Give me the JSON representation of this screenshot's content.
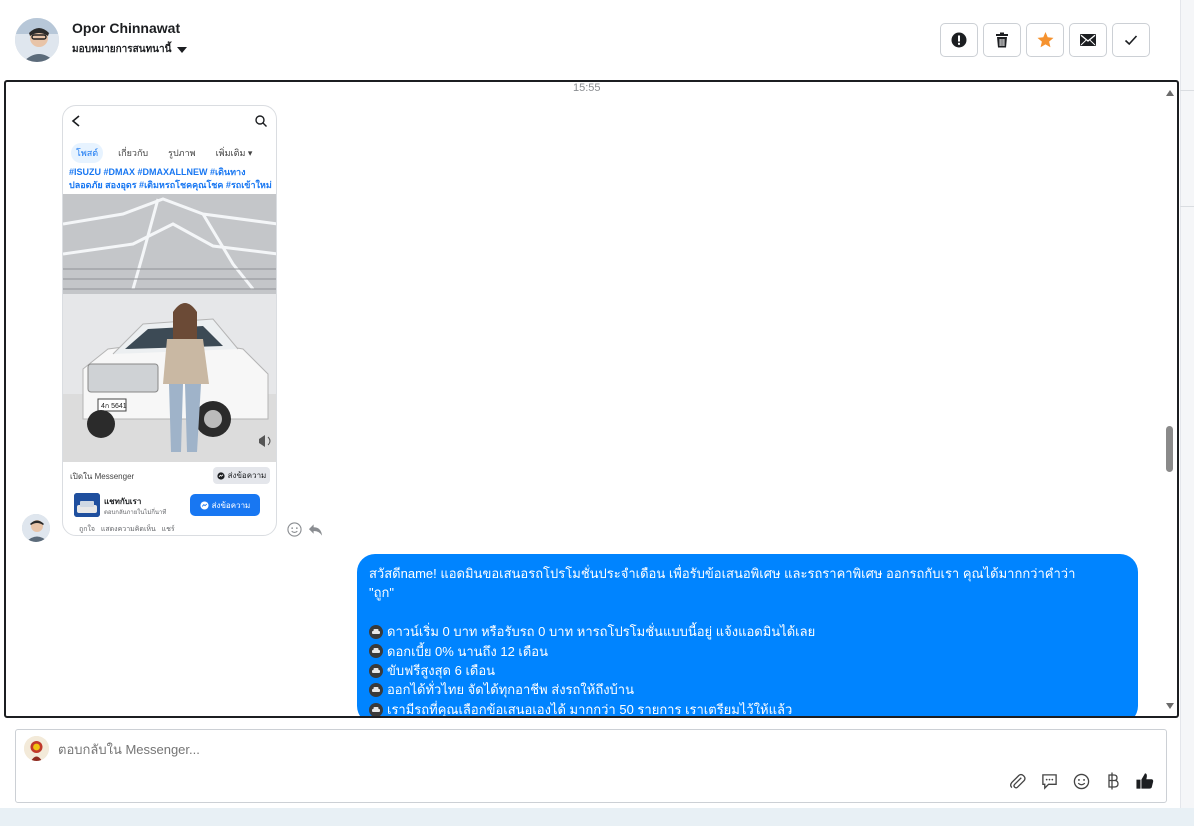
{
  "header": {
    "contact_name": "Opor Chinnawat",
    "assign_label": "มอบหมายการสนทนานี้",
    "actions": [
      {
        "name": "report-button",
        "icon": "alert-circle-icon"
      },
      {
        "name": "delete-button",
        "icon": "trash-icon"
      },
      {
        "name": "star-button",
        "icon": "star-icon",
        "color": "#f5922f"
      },
      {
        "name": "mark-unread-button",
        "icon": "envelope-icon"
      },
      {
        "name": "done-button",
        "icon": "check-icon"
      }
    ]
  },
  "conversation": {
    "timestamp": "15:55",
    "attachment": {
      "tabs": [
        "โพสต์",
        "เกี่ยวกับ",
        "รูปภาพ",
        "เพิ่มเติม"
      ],
      "caption": "#ISUZU #DMAX #DMAXALLNEW #เดินทางปลอดภัย สองอุดร #เติมหรถโชคคุณโชค #รถเข้าใหม่",
      "plate_text": "4ก 5641",
      "open_in_label": "เปิดใน Messenger",
      "send_chip_label": "ส่งข้อความ",
      "card_title": "แชทกับเรา",
      "card_subtitle": "ตอบกลับภายในไม่กี่นาที",
      "card_button_label": "ส่งข้อความ",
      "bottom_strip": "ถูกใจ   แสดงความคิดเห็น   แชร์"
    },
    "outgoing_message": {
      "line1": "สวัสดีname! แอดมินขอเสนอรถโปรโมชั่นประจำเดือน เพื่อรับข้อเสนอพิเศษ และรถราคาพิเศษ ออกรถกับเรา คุณได้มากกว่าคำว่า",
      "line2": "\"ถูก\"",
      "bullets": [
        "ดาวน์เริ่ม 0 บาท หรือรับรถ 0 บาท หารถโปรโมชั่นแบบนี้อยู่ แจ้งแอดมินได้เลย",
        "ดอกเบี้ย 0% นานถึง 12 เดือน",
        "ขับฟรีสูงสุด 6 เดือน",
        "ออกได้ทั่วไทย จัดได้ทุกอาชีพ ส่งรถให้ถึงบ้าน",
        "เรามีรถที่คุณเลือกข้อเสนอเองได้ มากกว่า 50 รายการ เราเตรียมไว้ให้แล้ว"
      ],
      "bubble_color": "#0084ff"
    }
  },
  "composer": {
    "placeholder": "ตอบกลับใน Messenger...",
    "tools": [
      "attachment-icon",
      "saved-replies-icon",
      "emoji-icon",
      "baht-icon",
      "thumbs-up-icon"
    ]
  }
}
